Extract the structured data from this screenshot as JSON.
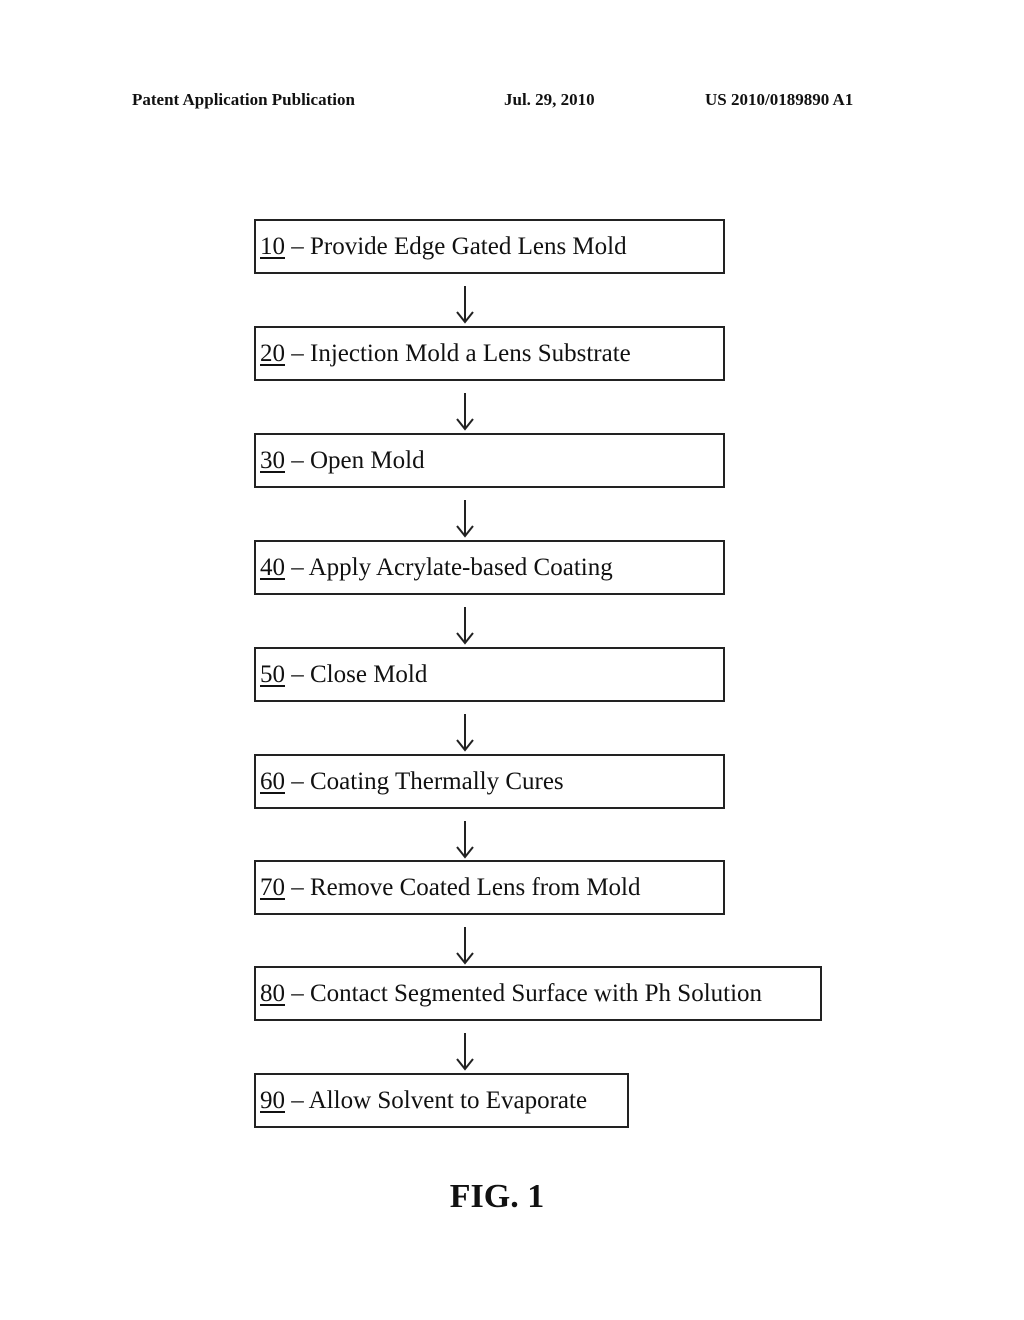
{
  "header": {
    "left": "Patent Application Publication",
    "middle": "Jul. 29, 2010",
    "right": "US 2010/0189890 A1"
  },
  "steps": [
    {
      "number": "10",
      "label": " – Provide Edge Gated Lens Mold"
    },
    {
      "number": "20",
      "label": " – Injection Mold a Lens Substrate"
    },
    {
      "number": "30",
      "label": " – Open Mold"
    },
    {
      "number": "40",
      "label": " – Apply Acrylate-based Coating"
    },
    {
      "number": "50",
      "label": " – Close Mold"
    },
    {
      "number": "60",
      "label": " – Coating Thermally Cures"
    },
    {
      "number": "70",
      "label": " – Remove Coated Lens from Mold"
    },
    {
      "number": "80",
      "label": " – Contact Segmented Surface with Ph Solution"
    },
    {
      "number": "90",
      "label": " – Allow Solvent to Evaporate"
    }
  ],
  "figure_label": "FIG. 1"
}
